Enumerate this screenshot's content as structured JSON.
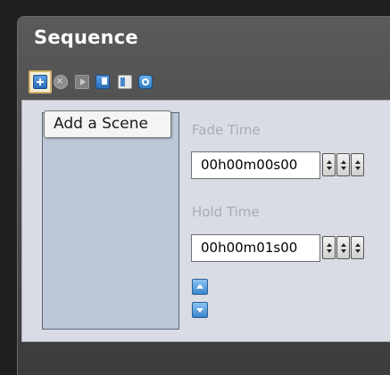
{
  "panel": {
    "title": "Sequence"
  },
  "toolbar": {
    "buttons": [
      {
        "icon": "add-scene-icon",
        "active": true
      },
      {
        "icon": "remove-scene-icon"
      },
      {
        "icon": "play-icon"
      },
      {
        "icon": "copy-icon"
      },
      {
        "icon": "paste-icon"
      },
      {
        "icon": "settings-icon"
      }
    ],
    "tooltip": "Add a Scene"
  },
  "fields": {
    "fade_time": {
      "label": "Fade Time",
      "value": "00h00m00s00"
    },
    "hold_time": {
      "label": "Hold Time",
      "value": "00h00m01s00"
    }
  },
  "colors": {
    "panel_bg": "#4a4a4a",
    "content_bg": "#d9dce4",
    "list_bg": "#bcc8d8",
    "accent_blue": "#2c6cb8",
    "label_gray": "#a7acb6"
  }
}
